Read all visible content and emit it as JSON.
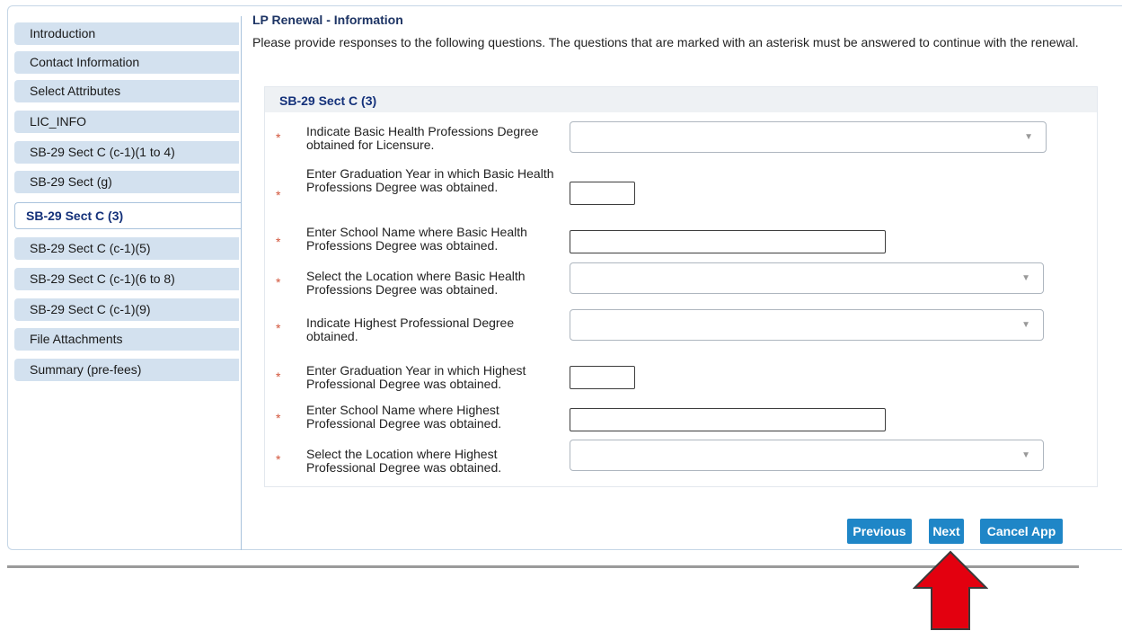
{
  "sidebar": {
    "items": [
      {
        "label": "Introduction"
      },
      {
        "label": "Contact Information"
      },
      {
        "label": "Select Attributes"
      },
      {
        "label": "LIC_INFO"
      },
      {
        "label": "SB-29 Sect C (c-1)(1 to 4)"
      },
      {
        "label": "SB-29 Sect (g)"
      },
      {
        "label": "SB-29 Sect C (3)"
      },
      {
        "label": "SB-29 Sect C (c-1)(5)"
      },
      {
        "label": "SB-29 Sect C (c-1)(6 to 8)"
      },
      {
        "label": "SB-29 Sect C (c-1)(9)"
      },
      {
        "label": "File Attachments"
      },
      {
        "label": "Summary (pre-fees)"
      }
    ],
    "active_index": 6
  },
  "main": {
    "title": "LP Renewal - Information",
    "instructions": "Please provide responses to the following questions. The questions that are marked with an asterisk must be answered to continue with the renewal."
  },
  "section": {
    "title": "SB-29 Sect C (3)",
    "questions": [
      {
        "label": "Indicate Basic Health Professions Degree obtained for Licensure.",
        "type": "select",
        "value": "",
        "required": "*"
      },
      {
        "label": "Enter Graduation Year in which Basic Health Professions Degree was obtained.",
        "type": "text-short",
        "value": "",
        "required": "*"
      },
      {
        "label": "Enter School Name where Basic Health Professions Degree was obtained.",
        "type": "text-long",
        "value": "",
        "required": "*"
      },
      {
        "label": "Select the Location where Basic Health Professions Degree was obtained.",
        "type": "select",
        "value": "",
        "required": "*"
      },
      {
        "label": "Indicate Highest Professional Degree obtained.",
        "type": "select",
        "value": "",
        "required": "*"
      },
      {
        "label": "Enter Graduation Year in which Highest Professional Degree was obtained.",
        "type": "text-short",
        "value": "",
        "required": "*"
      },
      {
        "label": "Enter School Name where Highest Professional Degree was obtained.",
        "type": "text-long",
        "value": "",
        "required": "*"
      },
      {
        "label": "Select the Location where Highest Professional Degree was obtained.",
        "type": "select",
        "value": "",
        "required": "*"
      }
    ]
  },
  "buttons": {
    "previous": "Previous",
    "next": "Next",
    "cancel": "Cancel App"
  },
  "icons": {
    "dropdown_caret": "chevron-down-icon",
    "annotation_arrow": "arrow-up-icon"
  },
  "colors": {
    "accent_button": "#1f86c7",
    "nav_bg": "#d3e1ef",
    "asterisk": "#d2553b",
    "annotation_arrow": "#e3000f"
  }
}
